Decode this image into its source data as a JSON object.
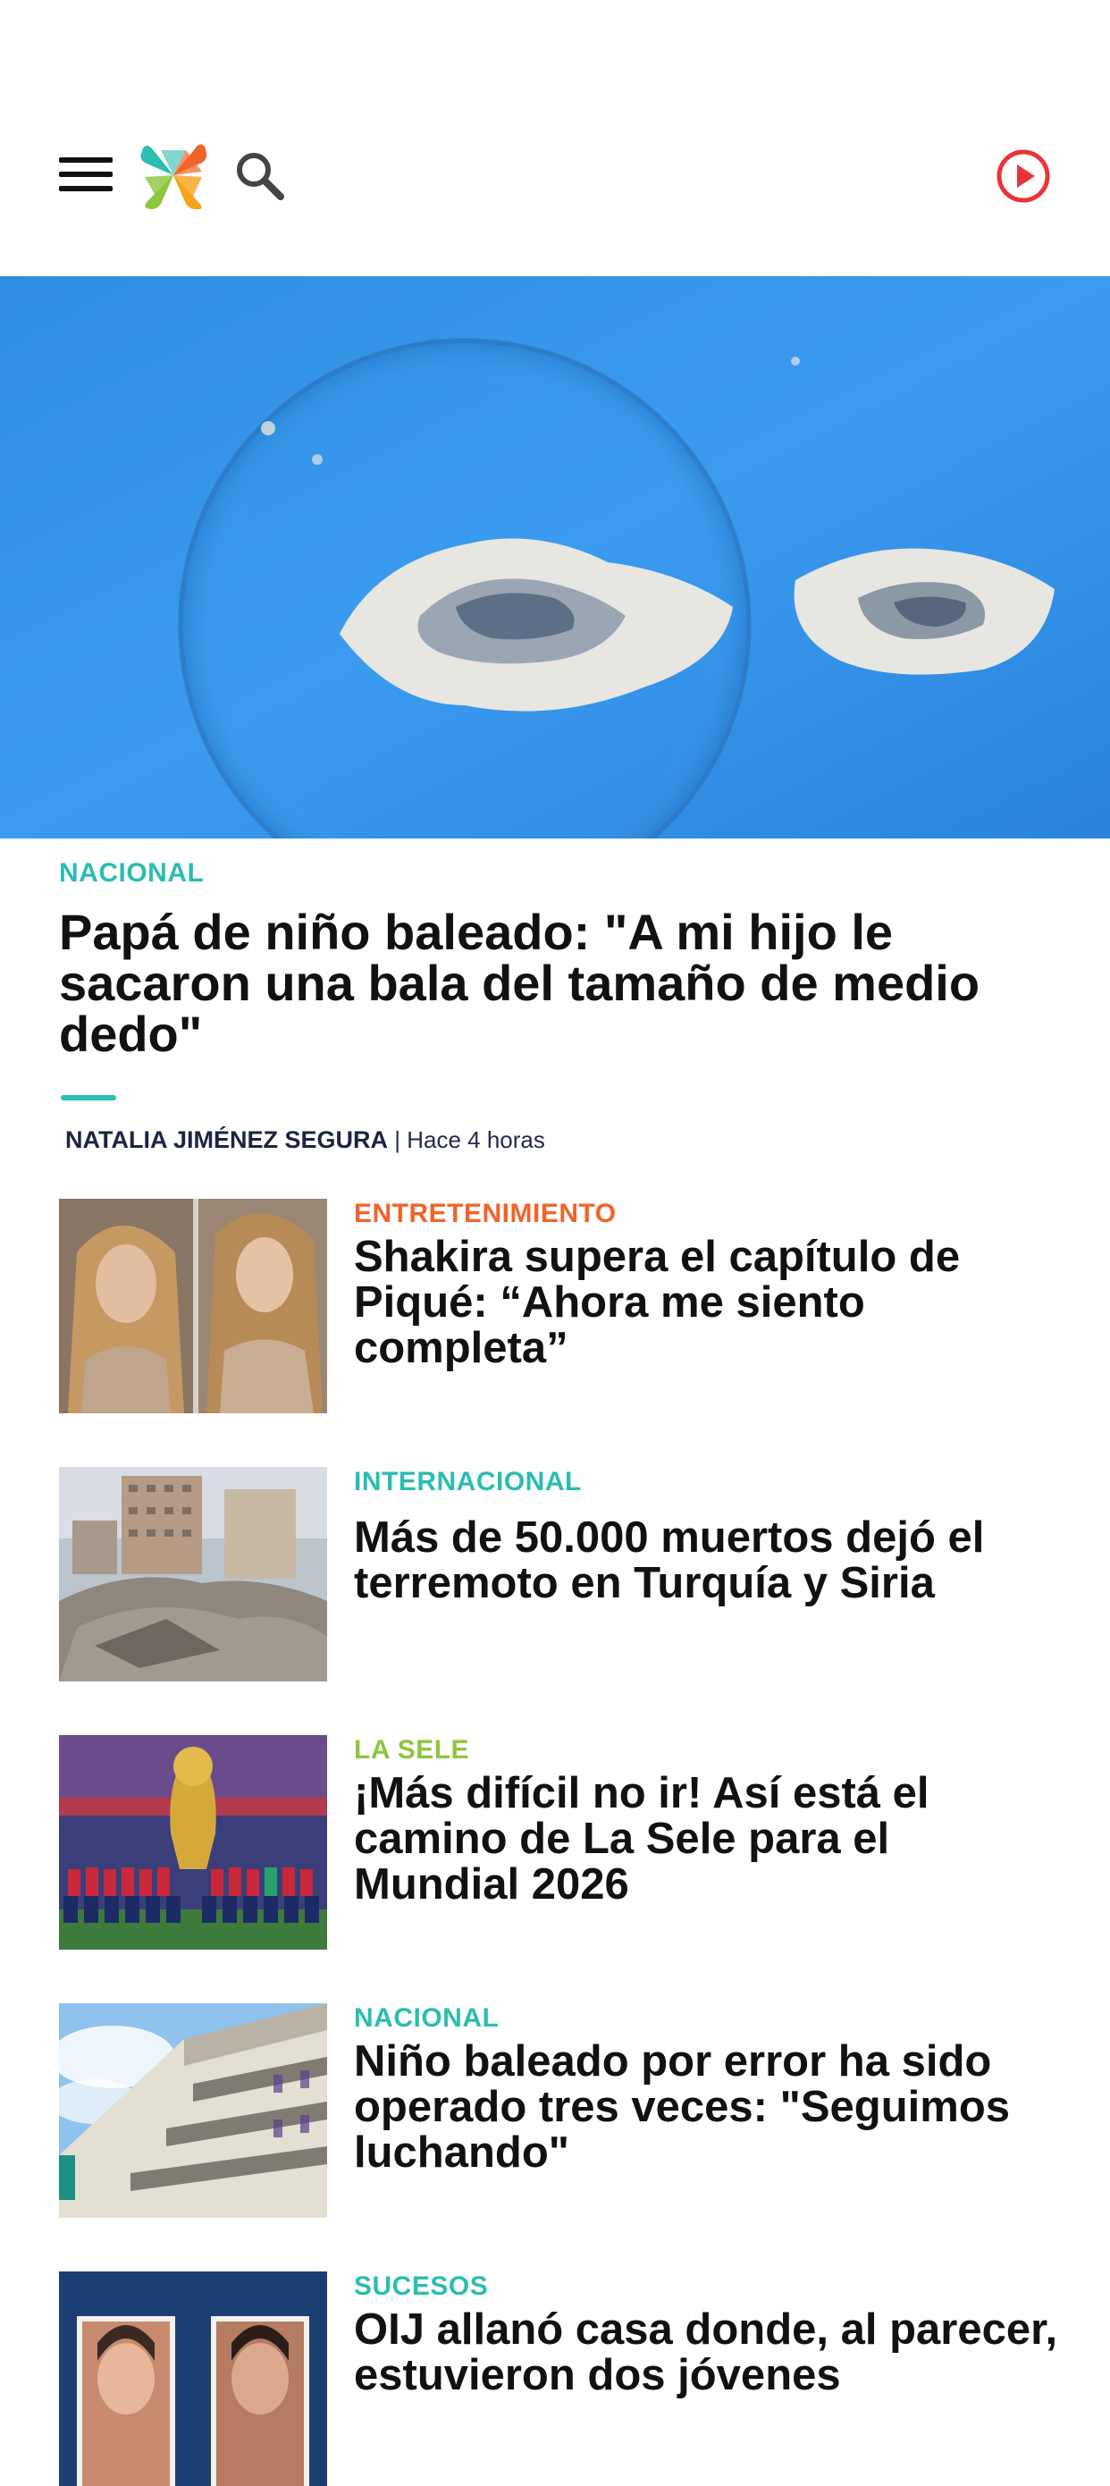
{
  "header": {
    "menu_icon": "hamburger-menu-icon",
    "logo_icon": "teletica-x-logo",
    "search_icon": "search-icon",
    "live_icon": "play-circle-icon",
    "live_color": "#ea3338"
  },
  "hero": {
    "category": "NACIONAL",
    "title": "Papá de niño baleado: \"A mi hijo le sacaron una bala del tamaño de medio dedo\"",
    "author": "NATALIA JIMÉNEZ SEGURA",
    "time": "| Hace 4 horas"
  },
  "articles": [
    {
      "category": "ENTRETENIMIENTO",
      "title": "Shakira supera el capítulo de Piqué: “Ahora me siento completa”"
    },
    {
      "category": "INTERNACIONAL",
      "title": "Más de 50.000 muertos dejó el terremoto en Turquía y Siria"
    },
    {
      "category": "LA SELE",
      "title": "¡Más difícil no ir! Así está el camino de La Sele para el Mundial 2026"
    },
    {
      "category": "NACIONAL",
      "title": "Niño baleado por error ha sido operado tres veces: \"Seguimos luchando\""
    },
    {
      "category": "SUCESOS",
      "title": "OIJ allanó casa donde, al parecer, estuvieron dos jóvenes"
    }
  ],
  "colors": {
    "teal": "#2bbdb0",
    "orange": "#f0642a",
    "green": "#8dc63f",
    "author": "#1b2442"
  }
}
